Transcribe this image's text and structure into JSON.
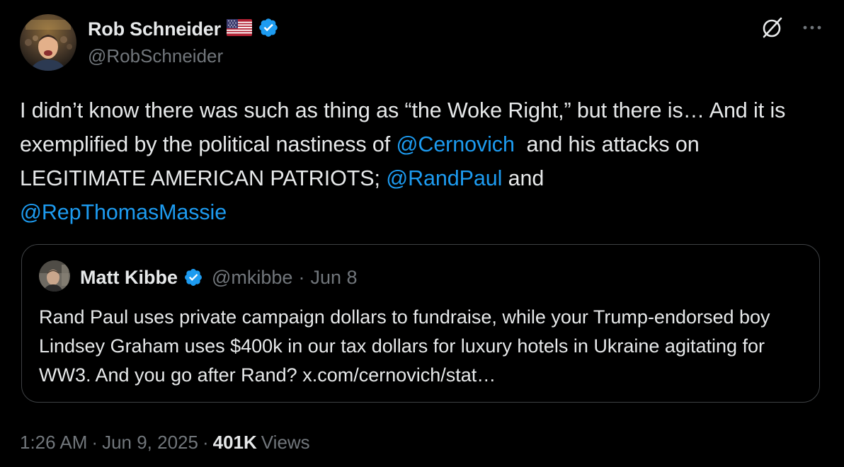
{
  "author": {
    "display_name": "Rob Schneider",
    "handle": "@RobSchneider",
    "flag_icon": "us-flag-icon",
    "verified_color": "#1d9bf0"
  },
  "post": {
    "segments": [
      {
        "text": "I didn’t know there was such as thing as “the Woke Right,” but there is… And it is exemplified by the political nastiness of ",
        "type": "text"
      },
      {
        "text": "@Cernovich",
        "type": "mention"
      },
      {
        "text": "  and his attacks on LEGITIMATE AMERICAN PATRIOTS; ",
        "type": "text"
      },
      {
        "text": "@RandPaul",
        "type": "mention"
      },
      {
        "text": " and ",
        "type": "text"
      },
      {
        "text": "@RepThomasMassie",
        "type": "mention"
      }
    ]
  },
  "quoted": {
    "display_name": "Matt Kibbe",
    "handle": "@mkibbe",
    "separator": "·",
    "date": "Jun 8",
    "text": "Rand Paul uses private campaign dollars to fundraise, while your Trump-endorsed boy Lindsey Graham uses $400k in our tax dollars for luxury hotels in Ukraine agitating for WW3. And you go after Rand? x.com/cernovich/stat…"
  },
  "meta": {
    "time": "1:26 AM",
    "sep1": "·",
    "date": "Jun 9, 2025",
    "sep2": "·",
    "views_count": "401K",
    "views_label": "Views"
  },
  "colors": {
    "background": "#000000",
    "text": "#e7e9ea",
    "muted": "#71767b",
    "link": "#1d9bf0",
    "border": "#3e4144"
  },
  "icons": [
    "grok-icon",
    "more-icon",
    "verified-badge-icon",
    "us-flag-icon"
  ]
}
